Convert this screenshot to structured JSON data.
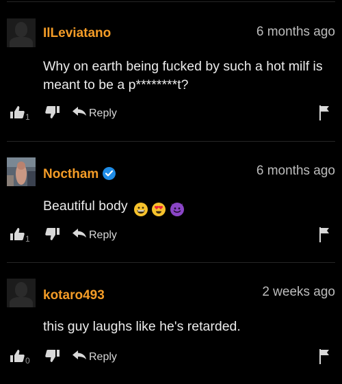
{
  "comments": [
    {
      "username": "IlLeviatano",
      "time": "6 months ago",
      "text": "Why on earth being fucked by such a hot milf is meant to be a p********t?",
      "likes": "1",
      "reply_label": "Reply",
      "verified": false,
      "avatar": "default-silhouette"
    },
    {
      "username": "Noctham",
      "time": "6 months ago",
      "text": "Beautiful body",
      "emojis": [
        "grinning-face-emoji",
        "heart-eyes-emoji",
        "smiling-imp-emoji"
      ],
      "likes": "1",
      "reply_label": "Reply",
      "verified": true,
      "avatar": "photo"
    },
    {
      "username": "kotaro493",
      "time": "2 weeks ago",
      "text": "this guy laughs like he's retarded.",
      "likes": "0",
      "reply_label": "Reply",
      "verified": false,
      "avatar": "default-silhouette"
    }
  ],
  "colors": {
    "background": "#000000",
    "username": "#f49c27",
    "text": "#ececec",
    "time": "#bdbdbd",
    "verified": "#1f8ce6",
    "icon": "#d8d8d8"
  }
}
